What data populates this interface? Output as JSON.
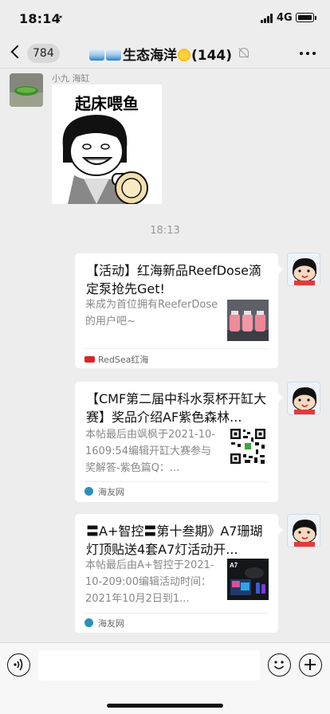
{
  "status_bar": {
    "time": "18:14",
    "network": "4G"
  },
  "nav": {
    "back_badge": "784",
    "title_text": "生态海洋",
    "member_count": "(144)"
  },
  "messages": {
    "sender_name": "小九 海缸",
    "sticker_text": "起床喂鱼",
    "time_divider": "18:13",
    "cards": [
      {
        "title": "【活动】红海新品ReefDose滴定泵抢先Get!",
        "desc": "来成为首位拥有ReeferDose的用户吧~",
        "source": "RedSea红海",
        "source_color": "#d9252a"
      },
      {
        "title": "【CMF第二届中科水泵杯开缸大赛】奖品介绍AF紫色森林...",
        "desc": "本帖最后由飒枫于2021-10-1609:54编辑开缸大赛参与奖解答-紫色篇Q：...",
        "source": "海友网",
        "source_color": "#2a8fbf"
      },
      {
        "title": "〓A+智控〓第十叁期》A7珊瑚灯顶贴送4套A7灯活动开...",
        "desc": "本帖最后由A+智控于2021-10-209:00编辑活动时间：2021年10月2日到1...",
        "source": "海友网",
        "source_color": "#2a8fbf"
      }
    ]
  },
  "input_bar": {
    "placeholder": ""
  }
}
